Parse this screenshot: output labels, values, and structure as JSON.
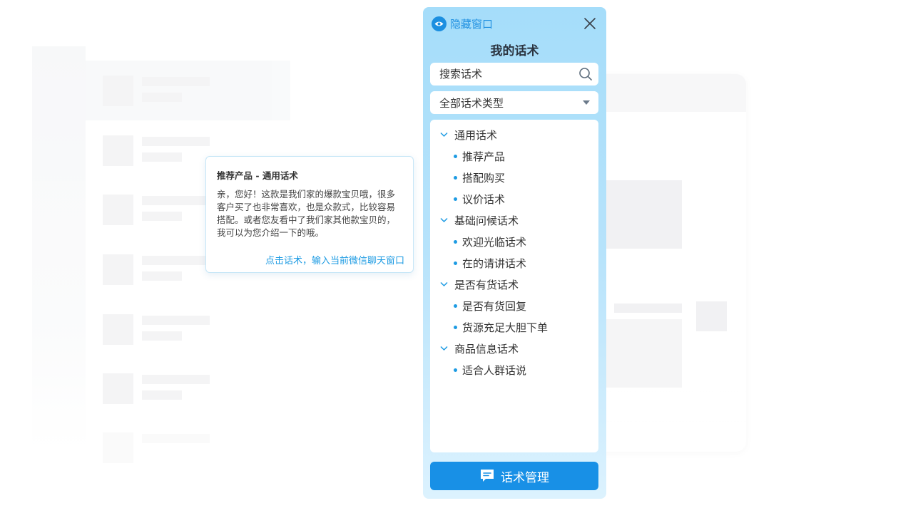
{
  "panel": {
    "hide_label": "隐藏窗口",
    "title": "我的话术",
    "search": {
      "placeholder": "搜索话术",
      "value": ""
    },
    "type_select": {
      "selected": "全部话术类型"
    },
    "groups": [
      {
        "label": "通用话术",
        "items": [
          "推荐产品",
          "搭配购买",
          "议价话术"
        ]
      },
      {
        "label": "基础问候话术",
        "items": [
          "欢迎光临话术",
          "在的请讲话术"
        ]
      },
      {
        "label": "是否有货话术",
        "items": [
          "是否有货回复",
          "货源充足大胆下单"
        ]
      },
      {
        "label": "商品信息话术",
        "items": [
          "适合人群话说"
        ]
      }
    ],
    "manage_label": "话术管理",
    "colors": {
      "accent": "#1890e6",
      "dot": "#1d9be3",
      "panel_bg": "#a5ddfa"
    }
  },
  "tooltip": {
    "title": "推荐产品 - 通用话术",
    "body": "亲，您好！这款是我们家的爆款宝贝哦，很多客户买了也非常喜欢，也是众款式，比较容易搭配。或者您友看中了我们家其他款宝贝的，我可以为您介绍一下的哦。",
    "action": "点击话术，输入当前微信聊天窗口"
  }
}
